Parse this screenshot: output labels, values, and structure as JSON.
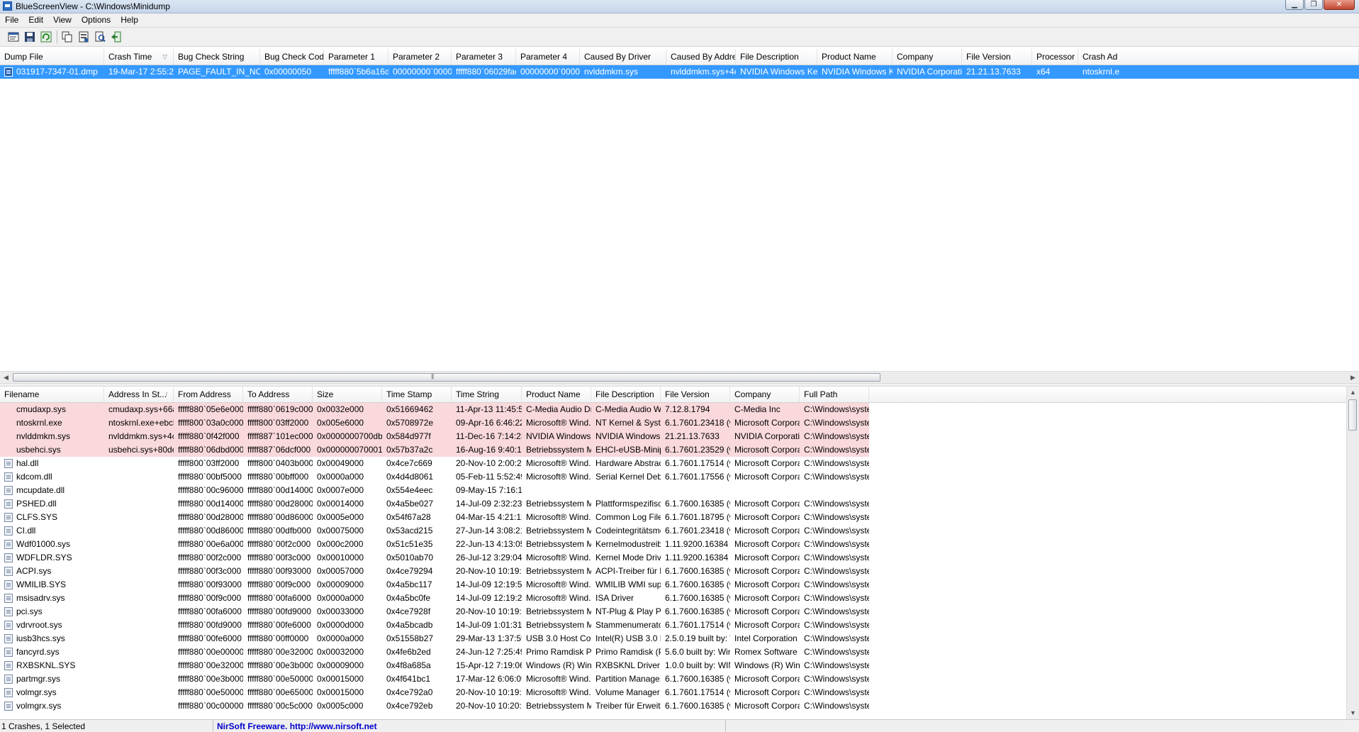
{
  "window": {
    "title": "BlueScreenView  -  C:\\Windows\\Minidump"
  },
  "menu": [
    "File",
    "Edit",
    "View",
    "Options",
    "Help"
  ],
  "toolbar_icons": [
    "properties-icon",
    "save-icon",
    "refresh-icon",
    "copy-icon",
    "html-report-icon",
    "find-icon",
    "exit-icon"
  ],
  "top_list": {
    "columns": [
      "Dump File",
      "Crash Time",
      "Bug Check String",
      "Bug Check Code",
      "Parameter 1",
      "Parameter 2",
      "Parameter 3",
      "Parameter 4",
      "Caused By Driver",
      "Caused By Address",
      "File Description",
      "Product Name",
      "Company",
      "File Version",
      "Processor",
      "Crash Ad"
    ],
    "sort_column": "Crash Time",
    "rows": [
      [
        "031917-7347-01.dmp",
        "19-Mar-17 2:55:24 ...",
        "PAGE_FAULT_IN_NONP...",
        "0x00000050",
        "fffff880`5b6a16d0",
        "00000000`000000...",
        "fffff880`06029fac",
        "00000000`000000...",
        "nvlddmkm.sys",
        "nvlddmkm.sys+4c...",
        "NVIDIA Windows Kern...",
        "NVIDIA Windows Ke...",
        "NVIDIA Corporation",
        "21.21.13.7633",
        "x64",
        "ntoskrnl.e"
      ]
    ]
  },
  "bottom_list": {
    "columns": [
      "Filename",
      "Address In St...",
      "From Address",
      "To Address",
      "Size",
      "Time Stamp",
      "Time String",
      "Product Name",
      "File Description",
      "File Version",
      "Company",
      "Full Path"
    ],
    "sort_column": "Address In St...",
    "rows": [
      [
        "cmudaxp.sys",
        "cmudaxp.sys+66adb",
        "fffff880`05e6e000",
        "fffff880`0619c000",
        "0x0032e000",
        "0x51669462",
        "11-Apr-13 11:45:54...",
        "C-Media Audio Dri...",
        "C-Media Audio W...",
        "7.12.8.1794",
        "C-Media Inc",
        "C:\\Windows\\syste..."
      ],
      [
        "ntoskrnl.exe",
        "ntoskrnl.exe+ebcb1",
        "fffff800`03a0c000",
        "fffff800`03ff2000",
        "0x005e6000",
        "0x5708972e",
        "09-Apr-16 6:46:22 ...",
        "Microsoft® Wind...",
        "NT Kernel & System",
        "6.1.7601.23418 (wi...",
        "Microsoft Corpora...",
        "C:\\Windows\\syste..."
      ],
      [
        "nvlddmkm.sys",
        "nvlddmkm.sys+4c...",
        "fffff880`0f42f000",
        "fffff887`101ec000",
        "0x0000000700dbd0...",
        "0x584d977f",
        "11-Dec-16 7:14:23 ...",
        "NVIDIA Windows ...",
        "NVIDIA Windows ...",
        "21.21.13.7633",
        "NVIDIA Corporation",
        "C:\\Windows\\syste..."
      ],
      [
        "usbehci.sys",
        "usbehci.sys+80de0...",
        "fffff880`06dbd000",
        "fffff887`06dcf000",
        "0x0000000700012000",
        "0x57b37a2c",
        "16-Aug-16 9:40:12 ...",
        "Betriebssystem Mi...",
        "EHCI-eUSB-Minip...",
        "6.1.7601.23529 (wi...",
        "Microsoft Corpora...",
        "C:\\Windows\\syste..."
      ],
      [
        "hal.dll",
        "",
        "fffff800`03ff2000",
        "fffff800`0403b000",
        "0x00049000",
        "0x4ce7c669",
        "20-Nov-10 2:00:25 ...",
        "Microsoft® Wind...",
        "Hardware Abstract...",
        "6.1.7601.17514 (wi...",
        "Microsoft Corpora...",
        "C:\\Windows\\syste..."
      ],
      [
        "kdcom.dll",
        "",
        "fffff880`00bf5000",
        "fffff880`00bff000",
        "0x0000a000",
        "0x4d4d8061",
        "05-Feb-11 5:52:49 ...",
        "Microsoft® Wind...",
        "Serial Kernel Debu...",
        "6.1.7601.17556 (wi...",
        "Microsoft Corpora...",
        "C:\\Windows\\syste..."
      ],
      [
        "mcupdate.dll",
        "",
        "fffff880`00c96000",
        "fffff880`00d14000",
        "0x0007e000",
        "0x554e4eec",
        "09-May-15 7:16:12 ...",
        "",
        "",
        "",
        "",
        ""
      ],
      [
        "PSHED.dll",
        "",
        "fffff880`00d14000",
        "fffff880`00d28000",
        "0x00014000",
        "0x4a5be027",
        "14-Jul-09 2:32:23 A...",
        "Betriebssystem Mi...",
        "Plattformspezifisc...",
        "6.1.7600.16385 (wi...",
        "Microsoft Corpora...",
        "C:\\Windows\\syste..."
      ],
      [
        "CLFS.SYS",
        "",
        "fffff880`00d28000",
        "fffff880`00d86000",
        "0x0005e000",
        "0x54f67a28",
        "04-Mar-15 4:21:12 ...",
        "Microsoft® Wind...",
        "Common Log File ...",
        "6.1.7601.18795 (wi...",
        "Microsoft Corpora...",
        "C:\\Windows\\syste..."
      ],
      [
        "CI.dll",
        "",
        "fffff880`00d86000",
        "fffff880`00dfb000",
        "0x00075000",
        "0x53acd215",
        "27-Jun-14 3:08:21 ...",
        "Betriebssystem Mi...",
        "Codeintegritätsmo...",
        "6.1.7601.23418 (wi...",
        "Microsoft Corpora...",
        "C:\\Windows\\syste..."
      ],
      [
        "Wdf01000.sys",
        "",
        "fffff880`00e6a000",
        "fffff880`00f2c000",
        "0x000c2000",
        "0x51c51e35",
        "22-Jun-13 4:13:05 ...",
        "Betriebssystem Mi...",
        "Kernelmodustreib...",
        "1.11.9200.16384 (w...",
        "Microsoft Corpora...",
        "C:\\Windows\\syste..."
      ],
      [
        "WDFLDR.SYS",
        "",
        "fffff880`00f2c000",
        "fffff880`00f3c000",
        "0x00010000",
        "0x5010ab70",
        "26-Jul-12 3:29:04 A...",
        "Microsoft® Wind...",
        "Kernel Mode Drive...",
        "1.11.9200.16384 (wi...",
        "Microsoft Corpora...",
        "C:\\Windows\\syste..."
      ],
      [
        "ACPI.sys",
        "",
        "fffff880`00f3c000",
        "fffff880`00f93000",
        "0x00057000",
        "0x4ce79294",
        "20-Nov-10 10:19:1...",
        "Betriebssystem Mi...",
        "ACPI-Treiber für NT",
        "6.1.7600.16385 (wi...",
        "Microsoft Corpora...",
        "C:\\Windows\\syste..."
      ],
      [
        "WMILIB.SYS",
        "",
        "fffff880`00f93000",
        "fffff880`00f9c000",
        "0x00009000",
        "0x4a5bc117",
        "14-Jul-09 12:19:51 ...",
        "Microsoft® Wind...",
        "WMILIB WMI supp...",
        "6.1.7600.16385 (wi...",
        "Microsoft Corpora...",
        "C:\\Windows\\syste..."
      ],
      [
        "msisadrv.sys",
        "",
        "fffff880`00f9c000",
        "fffff880`00fa6000",
        "0x0000a000",
        "0x4a5bc0fe",
        "14-Jul-09 12:19:26 ...",
        "Microsoft® Wind...",
        "ISA Driver",
        "6.1.7600.16385 (wi...",
        "Microsoft Corpora...",
        "C:\\Windows\\syste..."
      ],
      [
        "pci.sys",
        "",
        "fffff880`00fa6000",
        "fffff880`00fd9000",
        "0x00033000",
        "0x4ce7928f",
        "20-Nov-10 10:19:1...",
        "Betriebssystem Mi...",
        "NT-Plug & Play P...",
        "6.1.7600.16385 (wi...",
        "Microsoft Corpora...",
        "C:\\Windows\\syste..."
      ],
      [
        "vdrvroot.sys",
        "",
        "fffff880`00fd9000",
        "fffff880`00fe6000",
        "0x0000d000",
        "0x4a5bcadb",
        "14-Jul-09 1:01:31 A...",
        "Betriebssystem Mi...",
        "Stammenumerato...",
        "6.1.7601.17514 (wi...",
        "Microsoft Corpora...",
        "C:\\Windows\\syste..."
      ],
      [
        "iusb3hcs.sys",
        "",
        "fffff880`00fe6000",
        "fffff880`00ff0000",
        "0x0000a000",
        "0x51558b27",
        "29-Mar-13 1:37:59 ...",
        "USB 3.0 Host Cont...",
        "Intel(R) USB 3.0 Ho...",
        "2.5.0.19 built by: W...",
        "Intel Corporation",
        "C:\\Windows\\syste..."
      ],
      [
        "fancyrd.sys",
        "",
        "fffff880`00e00000",
        "fffff880`00e32000",
        "0x00032000",
        "0x4fe6b2ed",
        "24-Jun-12 7:25:49 ...",
        "Primo Ramdisk Pr...",
        "Primo Ramdisk (Pr...",
        "5.6.0 built by: Win...",
        "Romex Software",
        "C:\\Windows\\syste..."
      ],
      [
        "RXBSKNL.SYS",
        "",
        "fffff880`00e32000",
        "fffff880`00e3b000",
        "0x00009000",
        "0x4f8a685a",
        "15-Apr-12 7:19:06 ...",
        "Windows (R) Win ...",
        "RXBSKNL Driver",
        "1.0.0 built by: WIN...",
        "Windows (R) Win ...",
        "C:\\Windows\\syste..."
      ],
      [
        "partmgr.sys",
        "",
        "fffff880`00e3b000",
        "fffff880`00e50000",
        "0x00015000",
        "0x4f641bc1",
        "17-Mar-12 6:06:09 ...",
        "Microsoft® Wind...",
        "Partition Manage...",
        "6.1.7600.16385 (wi...",
        "Microsoft Corpora...",
        "C:\\Windows\\syste..."
      ],
      [
        "volmgr.sys",
        "",
        "fffff880`00e50000",
        "fffff880`00e65000",
        "0x00015000",
        "0x4ce792a0",
        "20-Nov-10 10:19:2...",
        "Microsoft® Wind...",
        "Volume Manager ...",
        "6.1.7601.17514 (wi...",
        "Microsoft Corpora...",
        "C:\\Windows\\syste..."
      ],
      [
        "volmgrx.sys",
        "",
        "fffff880`00c00000",
        "fffff880`00c5c000",
        "0x0005c000",
        "0x4ce792eb",
        "20-Nov-10 10:20:4...",
        "Betriebssystem Mi...",
        "Treiber für Erweite...",
        "6.1.7600.16385 (wi...",
        "Microsoft Corpora...",
        "C:\\Windows\\syste..."
      ]
    ],
    "highlighted_count": 4
  },
  "status": {
    "left": "1 Crashes, 1 Selected",
    "right": "NirSoft Freeware.  http://www.nirsoft.net"
  },
  "colors": {
    "selection": "#3399ff",
    "highlight_row": "#f9d9dc",
    "link": "#0000cc"
  }
}
